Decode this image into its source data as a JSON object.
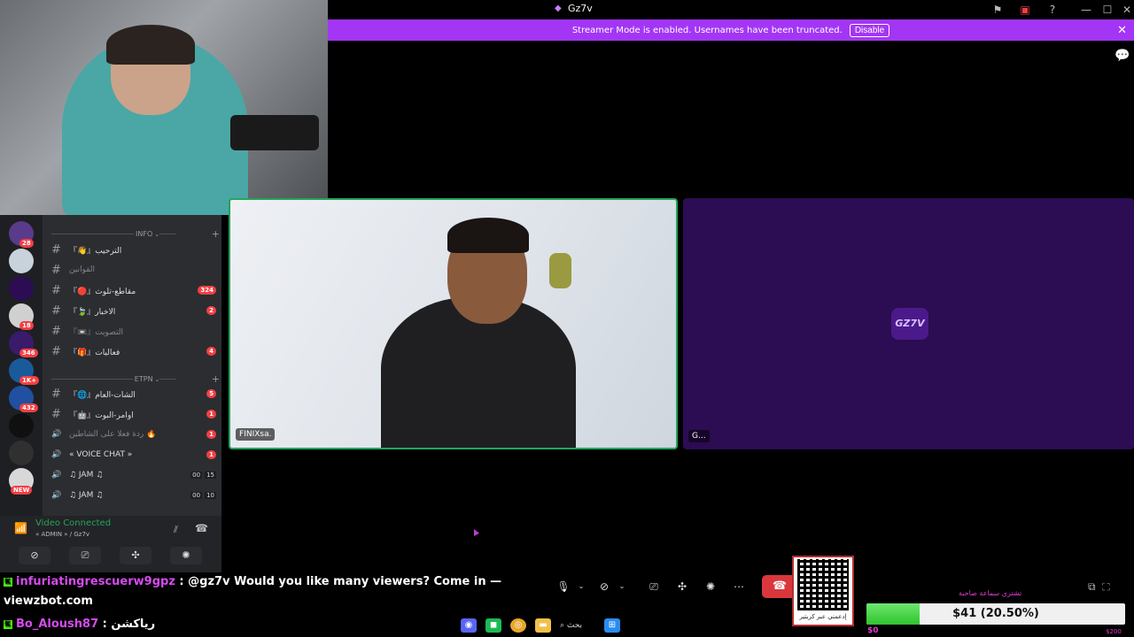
{
  "window": {
    "title": "Gz7v",
    "controls": [
      "—",
      "☐",
      "✕"
    ]
  },
  "banner": {
    "text": "Streamer Mode is enabled. Usernames have been truncated.",
    "disable_label": "Disable"
  },
  "servers": [
    {
      "badge": "28"
    },
    {
      "badge": ""
    },
    {
      "badge": ""
    },
    {
      "badge": "18"
    },
    {
      "badge": "346"
    },
    {
      "badge": "1K+"
    },
    {
      "badge": "432"
    },
    {
      "badge": ""
    },
    {
      "badge": ""
    },
    {
      "badge": "NEW"
    }
  ],
  "channels": {
    "category_info": "INFO",
    "category_etpn": "ETPN",
    "items": [
      {
        "name": "『👋』الترحيب",
        "badge": "",
        "muted": false
      },
      {
        "name": "القوانين",
        "badge": "",
        "muted": true
      },
      {
        "name": "『🔴』مقاطع-تلوث",
        "badge": "324",
        "muted": false
      },
      {
        "name": "『🍃』الاخبار",
        "badge": "2",
        "muted": false
      },
      {
        "name": "『📼』التصويت",
        "badge": "",
        "muted": true
      },
      {
        "name": "『🎁』فعاليات",
        "badge": "4",
        "muted": false
      },
      {
        "name": "『🌐』الشات-العام",
        "badge": "5",
        "muted": false
      },
      {
        "name": "『🤖』اوامر-البوت",
        "badge": "1",
        "muted": false
      },
      {
        "name": "ردة فعلا على الشاطين 🔥",
        "badge": "1",
        "muted": true
      },
      {
        "name": "« VOICE CHAT »",
        "badge": "1",
        "muted": false
      },
      {
        "name": "♫ JAM ♫",
        "count_a": "00",
        "count_b": "15"
      },
      {
        "name": "♫ JAM ♫",
        "count_a": "00",
        "count_b": "10"
      }
    ]
  },
  "voice": {
    "status": "Video Connected",
    "channel": "« ADMIN » / Gz7v"
  },
  "tiles": {
    "left_label": "FINIXsa.",
    "right_label": "G...",
    "right_avatar_text": "GZ7V"
  },
  "stream_chat": [
    {
      "user": "infuriatingrescuerw9gpz",
      "message": ": @gz7v Would you like many viewers? Come in —",
      "continuation": "viewzbot.com"
    },
    {
      "user": "Bo_Aloush87",
      "message": ": رياكشن"
    }
  ],
  "qr": {
    "caption": "إدعمني عبر كريتير"
  },
  "goal": {
    "title": "تشتري سماعة صاحبة",
    "text": "$41 (20.50%)",
    "fraction": 0.205,
    "min": "$0",
    "max": "$200"
  },
  "taskbar": {
    "search": "بحث"
  },
  "icons": {
    "end_call": "phone-hangup-icon",
    "chat": "chat-bubble-icon"
  }
}
